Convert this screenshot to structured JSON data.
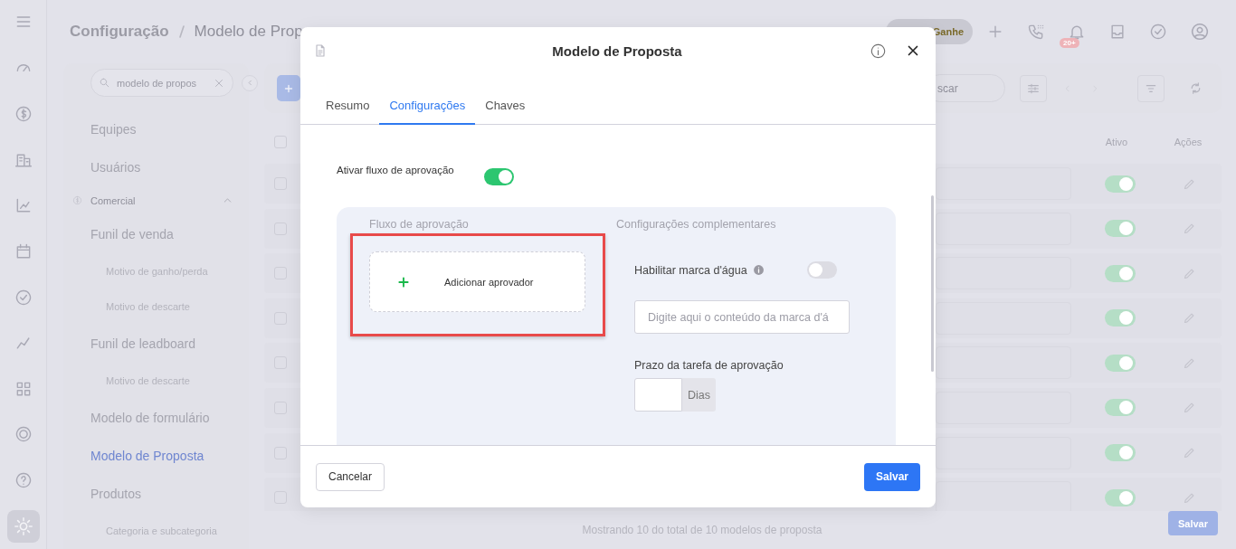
{
  "header": {
    "breadcrumb": [
      "Configuração",
      "Modelo de Prop"
    ],
    "promo_button": "Ganhe",
    "notification_badge": "20+"
  },
  "rail": {
    "items": [
      {
        "selected": false
      },
      {
        "selected": false
      },
      {
        "selected": false
      },
      {
        "selected": false
      },
      {
        "selected": false
      },
      {
        "selected": false
      },
      {
        "selected": false
      },
      {
        "selected": false
      },
      {
        "selected": false
      },
      {
        "selected": false
      },
      {
        "selected": true
      }
    ]
  },
  "sidebar": {
    "search": {
      "value": "modelo de propos"
    },
    "items": [
      {
        "kind": "item",
        "label": "Equipes",
        "selected": false
      },
      {
        "kind": "item",
        "label": "Usuários",
        "selected": false
      },
      {
        "kind": "section",
        "label": "Comercial",
        "expanded": true
      },
      {
        "kind": "item",
        "label": "Funil de venda",
        "selected": false
      },
      {
        "kind": "sub",
        "label": "Motivo de ganho/perda",
        "selected": false
      },
      {
        "kind": "sub",
        "label": "Motivo de descarte",
        "selected": false
      },
      {
        "kind": "item",
        "label": "Funil de leadboard",
        "selected": false
      },
      {
        "kind": "sub",
        "label": "Motivo de descarte",
        "selected": false
      },
      {
        "kind": "item",
        "label": "Modelo de formulário",
        "selected": false
      },
      {
        "kind": "item",
        "label": "Modelo de Proposta",
        "selected": true
      },
      {
        "kind": "item",
        "label": "Produtos",
        "selected": false
      },
      {
        "kind": "sub",
        "label": "Categoria e subcategoria",
        "selected": false
      }
    ]
  },
  "toolbar": {
    "search": {
      "placeholder": "scar"
    }
  },
  "table": {
    "columns": [
      "Ativo",
      "Ações"
    ],
    "all_checked": false,
    "rows": [
      {
        "checked": false,
        "active": true
      },
      {
        "checked": false,
        "active": true
      },
      {
        "checked": false,
        "active": true
      },
      {
        "checked": false,
        "active": true
      },
      {
        "checked": false,
        "active": true
      },
      {
        "checked": false,
        "active": true
      },
      {
        "checked": false,
        "active": true
      },
      {
        "checked": false,
        "active": true
      }
    ]
  },
  "footer": {
    "summary": "Mostrando 10 do total de 10 modelos de proposta",
    "save": "Salvar"
  },
  "modal": {
    "title": "Modelo de Proposta",
    "tabs": [
      {
        "label": "Resumo",
        "selected": false
      },
      {
        "label": "Configurações",
        "selected": true
      },
      {
        "label": "Chaves",
        "selected": false
      }
    ],
    "approval_toggle": {
      "label": "Ativar fluxo de aprovação",
      "on": true
    },
    "approval_flow": {
      "title": "Fluxo de aprovação",
      "add_label": "Adicionar aprovador"
    },
    "extras": {
      "title": "Configurações complementares",
      "watermark": {
        "label": "Habilitar marca d'água",
        "on": false,
        "placeholder": "Digite aqui o conteúdo da marca d'á"
      },
      "deadline": {
        "label": "Prazo da tarefa de aprovação",
        "unit": "Dias"
      }
    },
    "buttons": {
      "cancel": "Cancelar",
      "save": "Salvar"
    }
  }
}
